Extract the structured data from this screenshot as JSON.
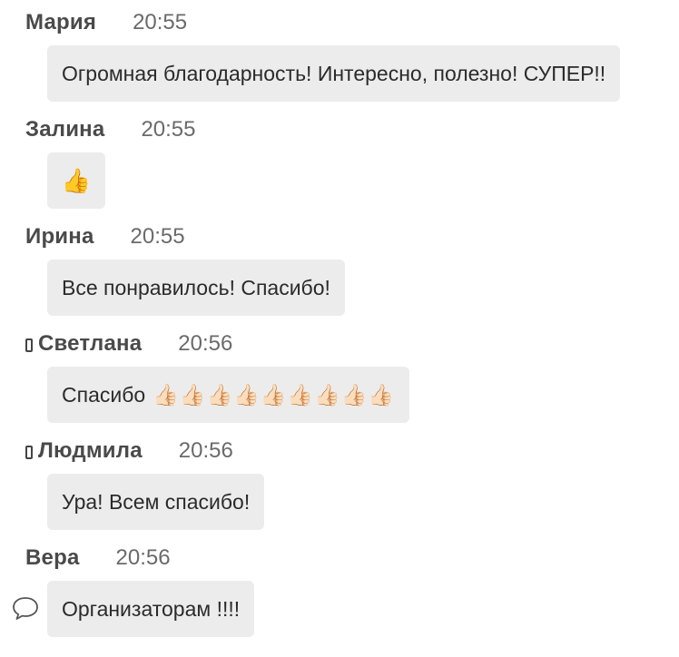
{
  "messages": [
    {
      "name": "Мария",
      "time": "20:55",
      "text": "Огромная благодарность! Интересно, полезно! СУПЕР!!",
      "mobile": false
    },
    {
      "name": "Залина",
      "time": "20:55",
      "text": "👍",
      "mobile": false
    },
    {
      "name": "Ирина",
      "time": "20:55",
      "text": "Все понравилось! Спасибо!",
      "mobile": false
    },
    {
      "name": "Светлана",
      "time": "20:56",
      "text": "Спасибо",
      "emoji": "👍🏻👍🏻👍🏻👍🏻👍🏻👍🏻👍🏻👍🏻👍🏻",
      "mobile": true
    },
    {
      "name": "Людмила",
      "time": "20:56",
      "text": "Ура! Всем спасибо!",
      "mobile": true
    },
    {
      "name": "Вера",
      "time": "20:56",
      "text": "Организаторам !!!!",
      "mobile": false
    }
  ],
  "icons": {
    "reply": "speech-bubble-icon",
    "mobile": "phone-icon"
  },
  "colors": {
    "bubble_bg": "#ececec",
    "name_text": "#4a4a4a",
    "time_text": "#6a6a6a"
  }
}
